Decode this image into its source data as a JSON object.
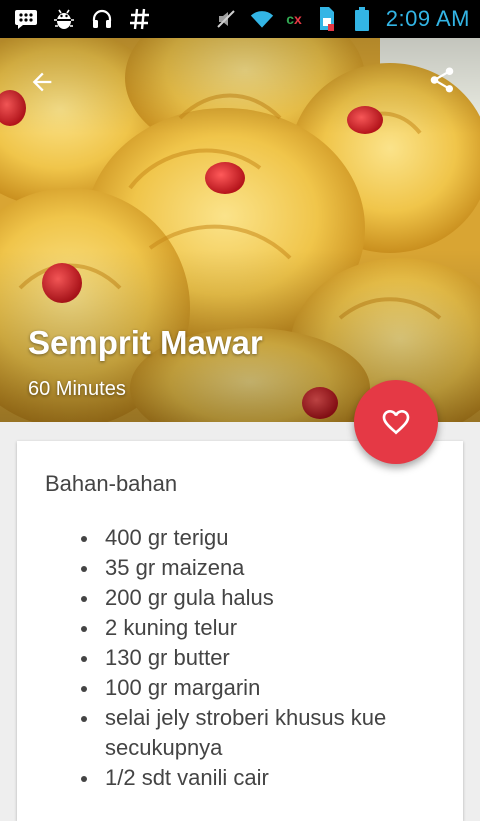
{
  "status_bar": {
    "left_icons": [
      "bbm-icon",
      "android-debug-icon",
      "headset-icon",
      "hash-icon"
    ],
    "right_icons": [
      "mute-icon",
      "wifi-icon",
      "sim-card-icon",
      "battery-icon"
    ],
    "carrier_mark": "cx",
    "time": "2:09 AM"
  },
  "hero": {
    "title": "Semprit Mawar",
    "subtitle": "60 Minutes",
    "back_icon": "arrow-back-icon",
    "share_icon": "share-icon"
  },
  "fab": {
    "icon": "heart-icon",
    "color": "#e53945"
  },
  "card": {
    "section_title": "Bahan-bahan",
    "ingredients": [
      "400 gr terigu",
      "35 gr maizena",
      "200 gr gula halus",
      "2 kuning telur",
      "130 gr butter",
      "100 gr margarin",
      "selai jely stroberi khusus kue secukupnya",
      "1/2 sdt vanili cair"
    ]
  },
  "colors": {
    "status_time": "#33b5e5",
    "accent": "#e53945",
    "text": "#444444",
    "background": "#eeeeee"
  }
}
